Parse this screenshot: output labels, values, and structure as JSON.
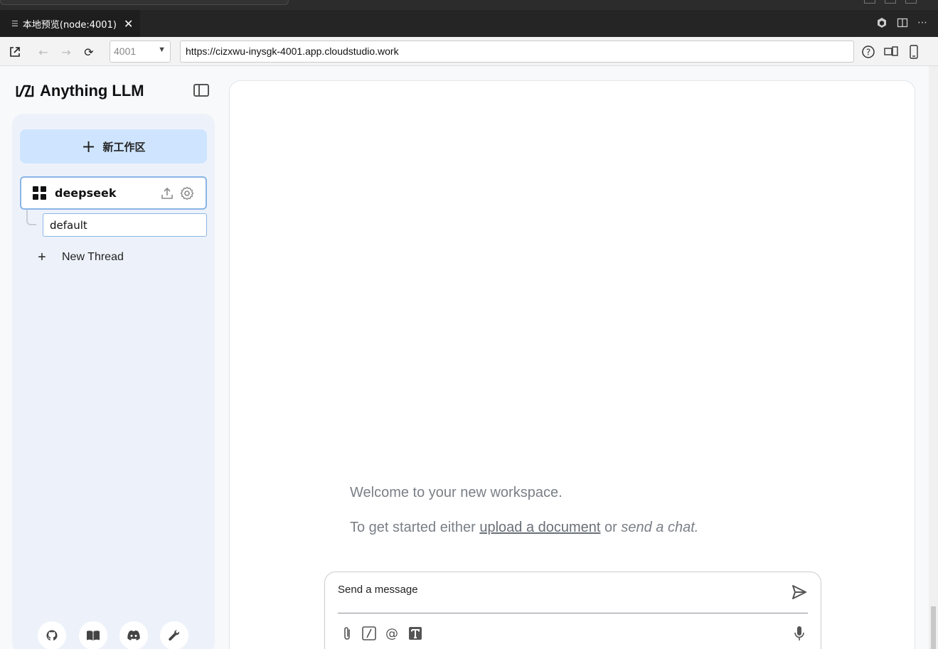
{
  "editor": {
    "tab_title": "本地预览(node:4001)",
    "tab_close": "✕"
  },
  "browser": {
    "port_value": "4001",
    "url": "https://cizxwu-inysgk-4001.app.cloudstudio.work"
  },
  "app": {
    "brand_name": "Anything LLM",
    "new_workspace_label": "新工作区",
    "workspace": {
      "name": "deepseek",
      "threads": [
        "default"
      ]
    },
    "new_thread_label": "New Thread",
    "welcome_line": "Welcome to your new workspace.",
    "get_started": {
      "prefix": "To get started either ",
      "upload_link": "upload a document",
      "middle": " or ",
      "chat_text": "send a chat."
    },
    "composer": {
      "placeholder": "Send a message"
    },
    "footer_icons": [
      "github-icon",
      "book-icon",
      "discord-icon",
      "wrench-icon"
    ]
  }
}
